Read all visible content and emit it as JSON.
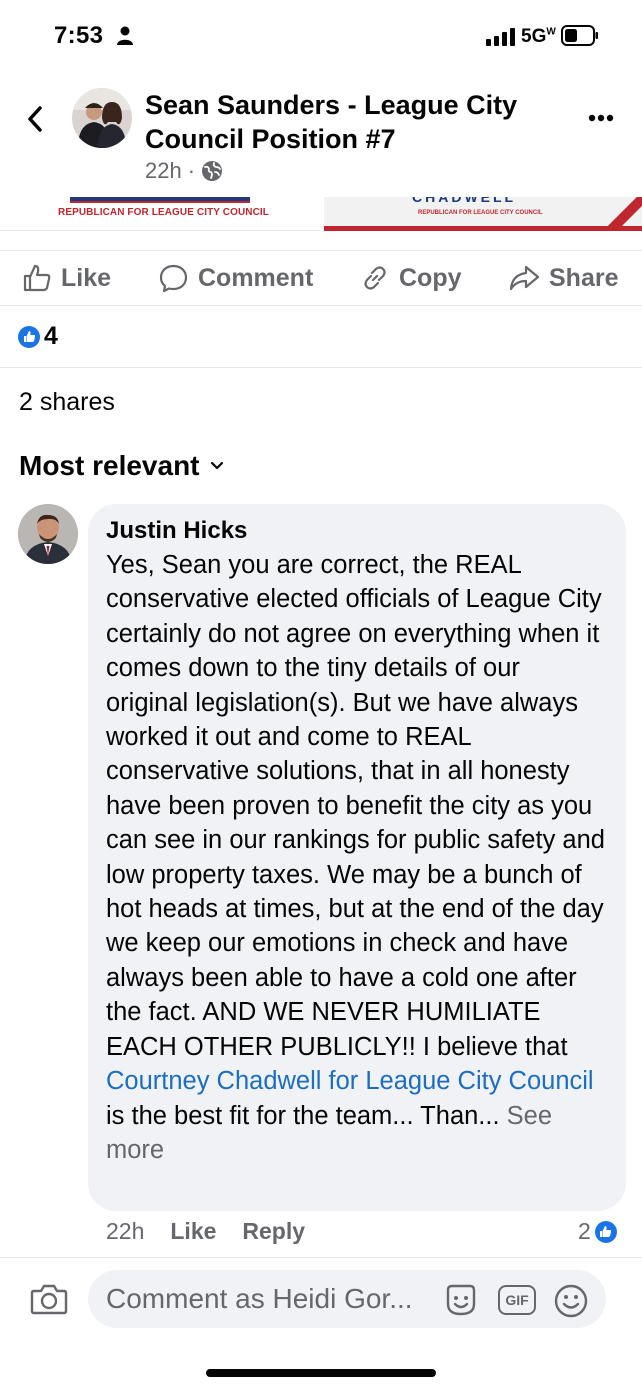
{
  "status_bar": {
    "time": "7:53",
    "network": "5G",
    "network_suffix": "W"
  },
  "header": {
    "title": "Sean Saunders - League City Council Position #7",
    "timestamp": "22h",
    "separator": "·",
    "audience_icon": "globe-icon"
  },
  "post_image": {
    "left_banner_text": "REPUBLICAN FOR LEAGUE CITY COUNCIL",
    "right_banner_name": "CHADWELL",
    "right_banner_text": "REPUBLICAN FOR LEAGUE CITY COUNCIL"
  },
  "actions": {
    "like": "Like",
    "comment": "Comment",
    "copy": "Copy",
    "share": "Share"
  },
  "reactions": {
    "count": "4",
    "icon": "like-reaction-icon"
  },
  "shares": "2 shares",
  "sort": {
    "label": "Most relevant"
  },
  "comment": {
    "author": "Justin Hicks",
    "text": "Yes, Sean you are correct, the REAL conservative elected officials of League City certainly do not agree on everything when it comes down to the tiny details of our original legislation(s). But we have always worked it out and come to REAL conservative solutions, that in all honesty have been proven to benefit the city as you can see in our rankings for public safety and low property taxes.  We may be a bunch of hot heads at times, but at the end of the day we keep our emotions in check and have always been able to have a cold one after the fact.  AND WE NEVER HUMILIATE EACH OTHER PUBLICLY!!  I believe that ",
    "link": "Courtney Chadwell for League City Council",
    "text_after": " is the best fit for the team... Than...",
    "see_more": " See more",
    "time": "22h",
    "like_label": "Like",
    "reply_label": "Reply",
    "like_count": "2"
  },
  "composer": {
    "placeholder": "Comment as Heidi Gor...",
    "gif_label": "GIF"
  },
  "colors": {
    "accent": "#1b74e4",
    "link": "#1b6ec2",
    "muted": "#65676b",
    "bubble": "#f0f2f5"
  }
}
